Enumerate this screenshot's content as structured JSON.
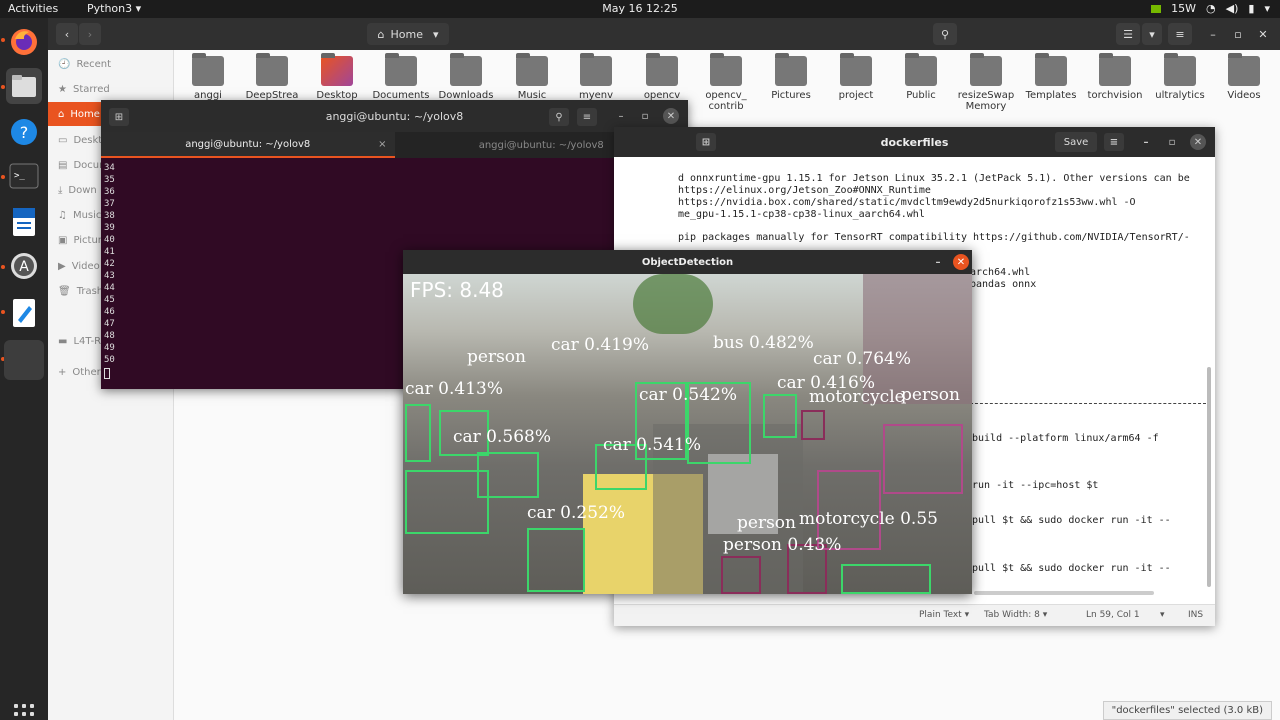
{
  "topbar": {
    "activities": "Activities",
    "app_menu": "Python3 ▾",
    "clock": "May 16  12:25",
    "power": "15W"
  },
  "dock": {
    "items": [
      "firefox-icon",
      "files-icon",
      "help-icon",
      "terminal-icon",
      "writer-icon",
      "software-icon",
      "text-editor-icon",
      "blank-app-icon"
    ]
  },
  "files": {
    "location": "Home",
    "sidebar": [
      {
        "label": "Recent",
        "icon": "🕘"
      },
      {
        "label": "Starred",
        "icon": "★"
      },
      {
        "label": "Home",
        "icon": "⌂"
      },
      {
        "label": "Deskto",
        "icon": "▭"
      },
      {
        "label": "Docum",
        "icon": "▤"
      },
      {
        "label": "Down",
        "icon": "⤓"
      },
      {
        "label": "Music",
        "icon": "♫"
      },
      {
        "label": "Pictur",
        "icon": "▣"
      },
      {
        "label": "Video",
        "icon": "▶"
      },
      {
        "label": "Trash",
        "icon": "🗑"
      },
      {
        "label": "L4T-R",
        "icon": "▬"
      },
      {
        "label": "Other",
        "icon": "+"
      }
    ],
    "folders": [
      "anggi",
      "DeepStrea",
      "Desktop",
      "Documents",
      "Downloads",
      "Music",
      "myenv",
      "opencv",
      "opencv_\ncontrib",
      "Pictures",
      "project",
      "Public",
      "resizeSwap\nMemory",
      "Templates",
      "torchvision",
      "ultralytics",
      "Videos"
    ],
    "status": "\"dockerfiles\" selected  (3.0 kB)"
  },
  "terminal": {
    "title": "anggi@ubuntu: ~/yolov8",
    "tabs": [
      "anggi@ubuntu: ~/yolov8",
      "anggi@ubuntu: ~/yolov8"
    ],
    "lines": [
      "34",
      "35",
      "36",
      "37",
      "38",
      "39",
      "40",
      "41",
      "42",
      "43",
      "44",
      "45",
      "46",
      "47",
      "48",
      "49",
      "50"
    ]
  },
  "editor": {
    "title": "dockerfiles",
    "save": "Save",
    "lines": [
      "d onnxruntime-gpu 1.15.1 for Jetson Linux 35.2.1 (JetPack 5.1). Other versions can be",
      "https://elinux.org/Jetson_Zoo#ONNX_Runtime",
      "https://nvidia.box.com/shared/static/mvdcltm9ewdy2d5nurkiqorofz1s53ww.whl -O",
      "me_gpu-1.15.1-cp38-cp38-linux_aarch64.whl",
      "pip packages manually for TensorRT compatibility https://github.com/NVIDIA/TensorRT/-",
      "arch64.whl",
      "pandas onnx",
      "build --platform linux/arm64 -f",
      "run -it --ipc=host $t",
      "pull $t && sudo docker run -it --",
      "pull $t && sudo docker run -it --"
    ],
    "status": {
      "syntax": "Plain Text ▾",
      "tab": "Tab Width: 8 ▾",
      "pos": "Ln 59, Col 1",
      "mode": "INS"
    }
  },
  "detection": {
    "title": "ObjectDetection",
    "fps": "FPS: 8.48",
    "labels": [
      "car 0.419%",
      "bus 0.482%",
      "person",
      "car 0.764%",
      "car 0.416%",
      "car 0.413%",
      "motorcycle",
      "person",
      "car 0.568%",
      "car 0.542%",
      "car 0.541%",
      "car 0.252%",
      "person",
      "motorcycle 0.55",
      "person 0.43%"
    ]
  }
}
